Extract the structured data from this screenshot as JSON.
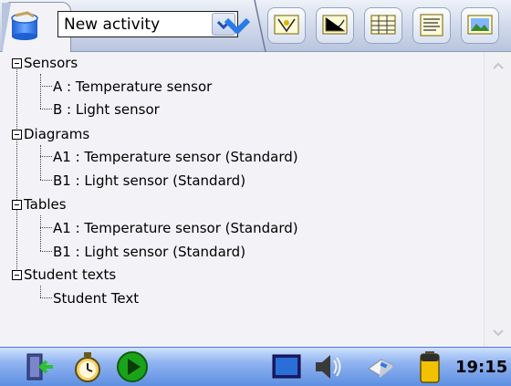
{
  "toolbar": {
    "activity_value": "New activity",
    "icons": [
      "database-icon",
      "probe-icon",
      "diagram-icon",
      "table-icon",
      "text-icon",
      "image-icon"
    ]
  },
  "tree": {
    "groups": [
      {
        "label": "Sensors",
        "children": [
          "A : Temperature sensor",
          "B : Light sensor"
        ]
      },
      {
        "label": "Diagrams",
        "children": [
          "A1 : Temperature sensor (Standard)",
          "B1 : Light sensor (Standard)"
        ]
      },
      {
        "label": "Tables",
        "children": [
          "A1 : Temperature sensor (Standard)",
          "B1 : Light sensor (Standard)"
        ]
      },
      {
        "label": "Student texts",
        "children": [
          "Student Text"
        ]
      }
    ]
  },
  "taskbar": {
    "clock": "19:15",
    "icons": [
      "exit-icon",
      "stopwatch-icon",
      "play-icon",
      "monitor-icon",
      "speaker-icon",
      "eraser-icon",
      "battery-icon"
    ]
  },
  "colors": {
    "accent": "#2a7be8",
    "play_green": "#1aa31a",
    "taskbar_blue": "#5d8fe1"
  }
}
